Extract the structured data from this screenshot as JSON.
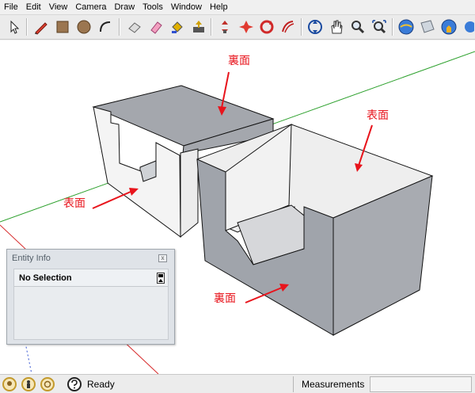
{
  "menu": [
    "File",
    "Edit",
    "View",
    "Camera",
    "Draw",
    "Tools",
    "Window",
    "Help"
  ],
  "toolbar": {
    "tools": [
      "select-arrow-icon",
      "pencil-line-icon",
      "rectangle-icon",
      "circle-icon",
      "arc-icon",
      "eraser-icon",
      "make-component-icon",
      "paint-bucket-icon",
      "push-pull-icon",
      "move-icon",
      "rotate-icon",
      "follow-me-icon",
      "orbit-icon",
      "pan-hand-icon",
      "zoom-icon",
      "zoom-extents-icon",
      "get-models-icon",
      "share-model-icon",
      "add-location-icon"
    ]
  },
  "annotations": {
    "back_top": "裏面",
    "front_right": "表面",
    "front_left": "表面",
    "back_bottom": "裏面"
  },
  "entity_info": {
    "title": "Entity Info",
    "selection": "No Selection"
  },
  "status": {
    "ready": "Ready",
    "measurements_label": "Measurements",
    "measurements_value": ""
  },
  "colors": {
    "axis_green": "#2ca02c",
    "axis_red": "#d62728",
    "annotation_red": "#e8141c",
    "face_front": "#f3f3f3",
    "face_back": "#a0a4ab"
  }
}
